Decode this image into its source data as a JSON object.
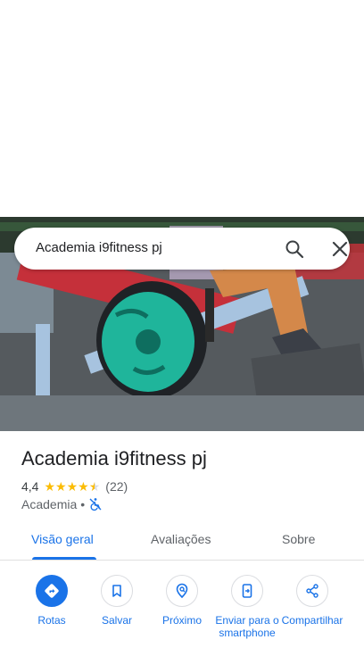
{
  "search": {
    "query": "Academia i9fitness pj"
  },
  "place": {
    "name": "Academia i9fitness pj",
    "rating": "4,4",
    "stars": 4.4,
    "review_count": "(22)",
    "category": "Academia",
    "separator": "•"
  },
  "tabs": [
    {
      "label": "Visão geral",
      "active": true
    },
    {
      "label": "Avaliações",
      "active": false
    },
    {
      "label": "Sobre",
      "active": false
    }
  ],
  "actions": [
    {
      "label": "Rotas",
      "icon": "directions-icon"
    },
    {
      "label": "Salvar",
      "icon": "bookmark-icon"
    },
    {
      "label": "Próximo",
      "icon": "nearby-icon"
    },
    {
      "label": "Enviar para o smartphone",
      "icon": "send-to-phone-icon"
    },
    {
      "label": "Compartilhar",
      "icon": "share-icon"
    }
  ],
  "colors": {
    "accent": "#1a73e8",
    "star": "#fbbc04",
    "text": "#202124",
    "secondary_text": "#5f6368"
  }
}
